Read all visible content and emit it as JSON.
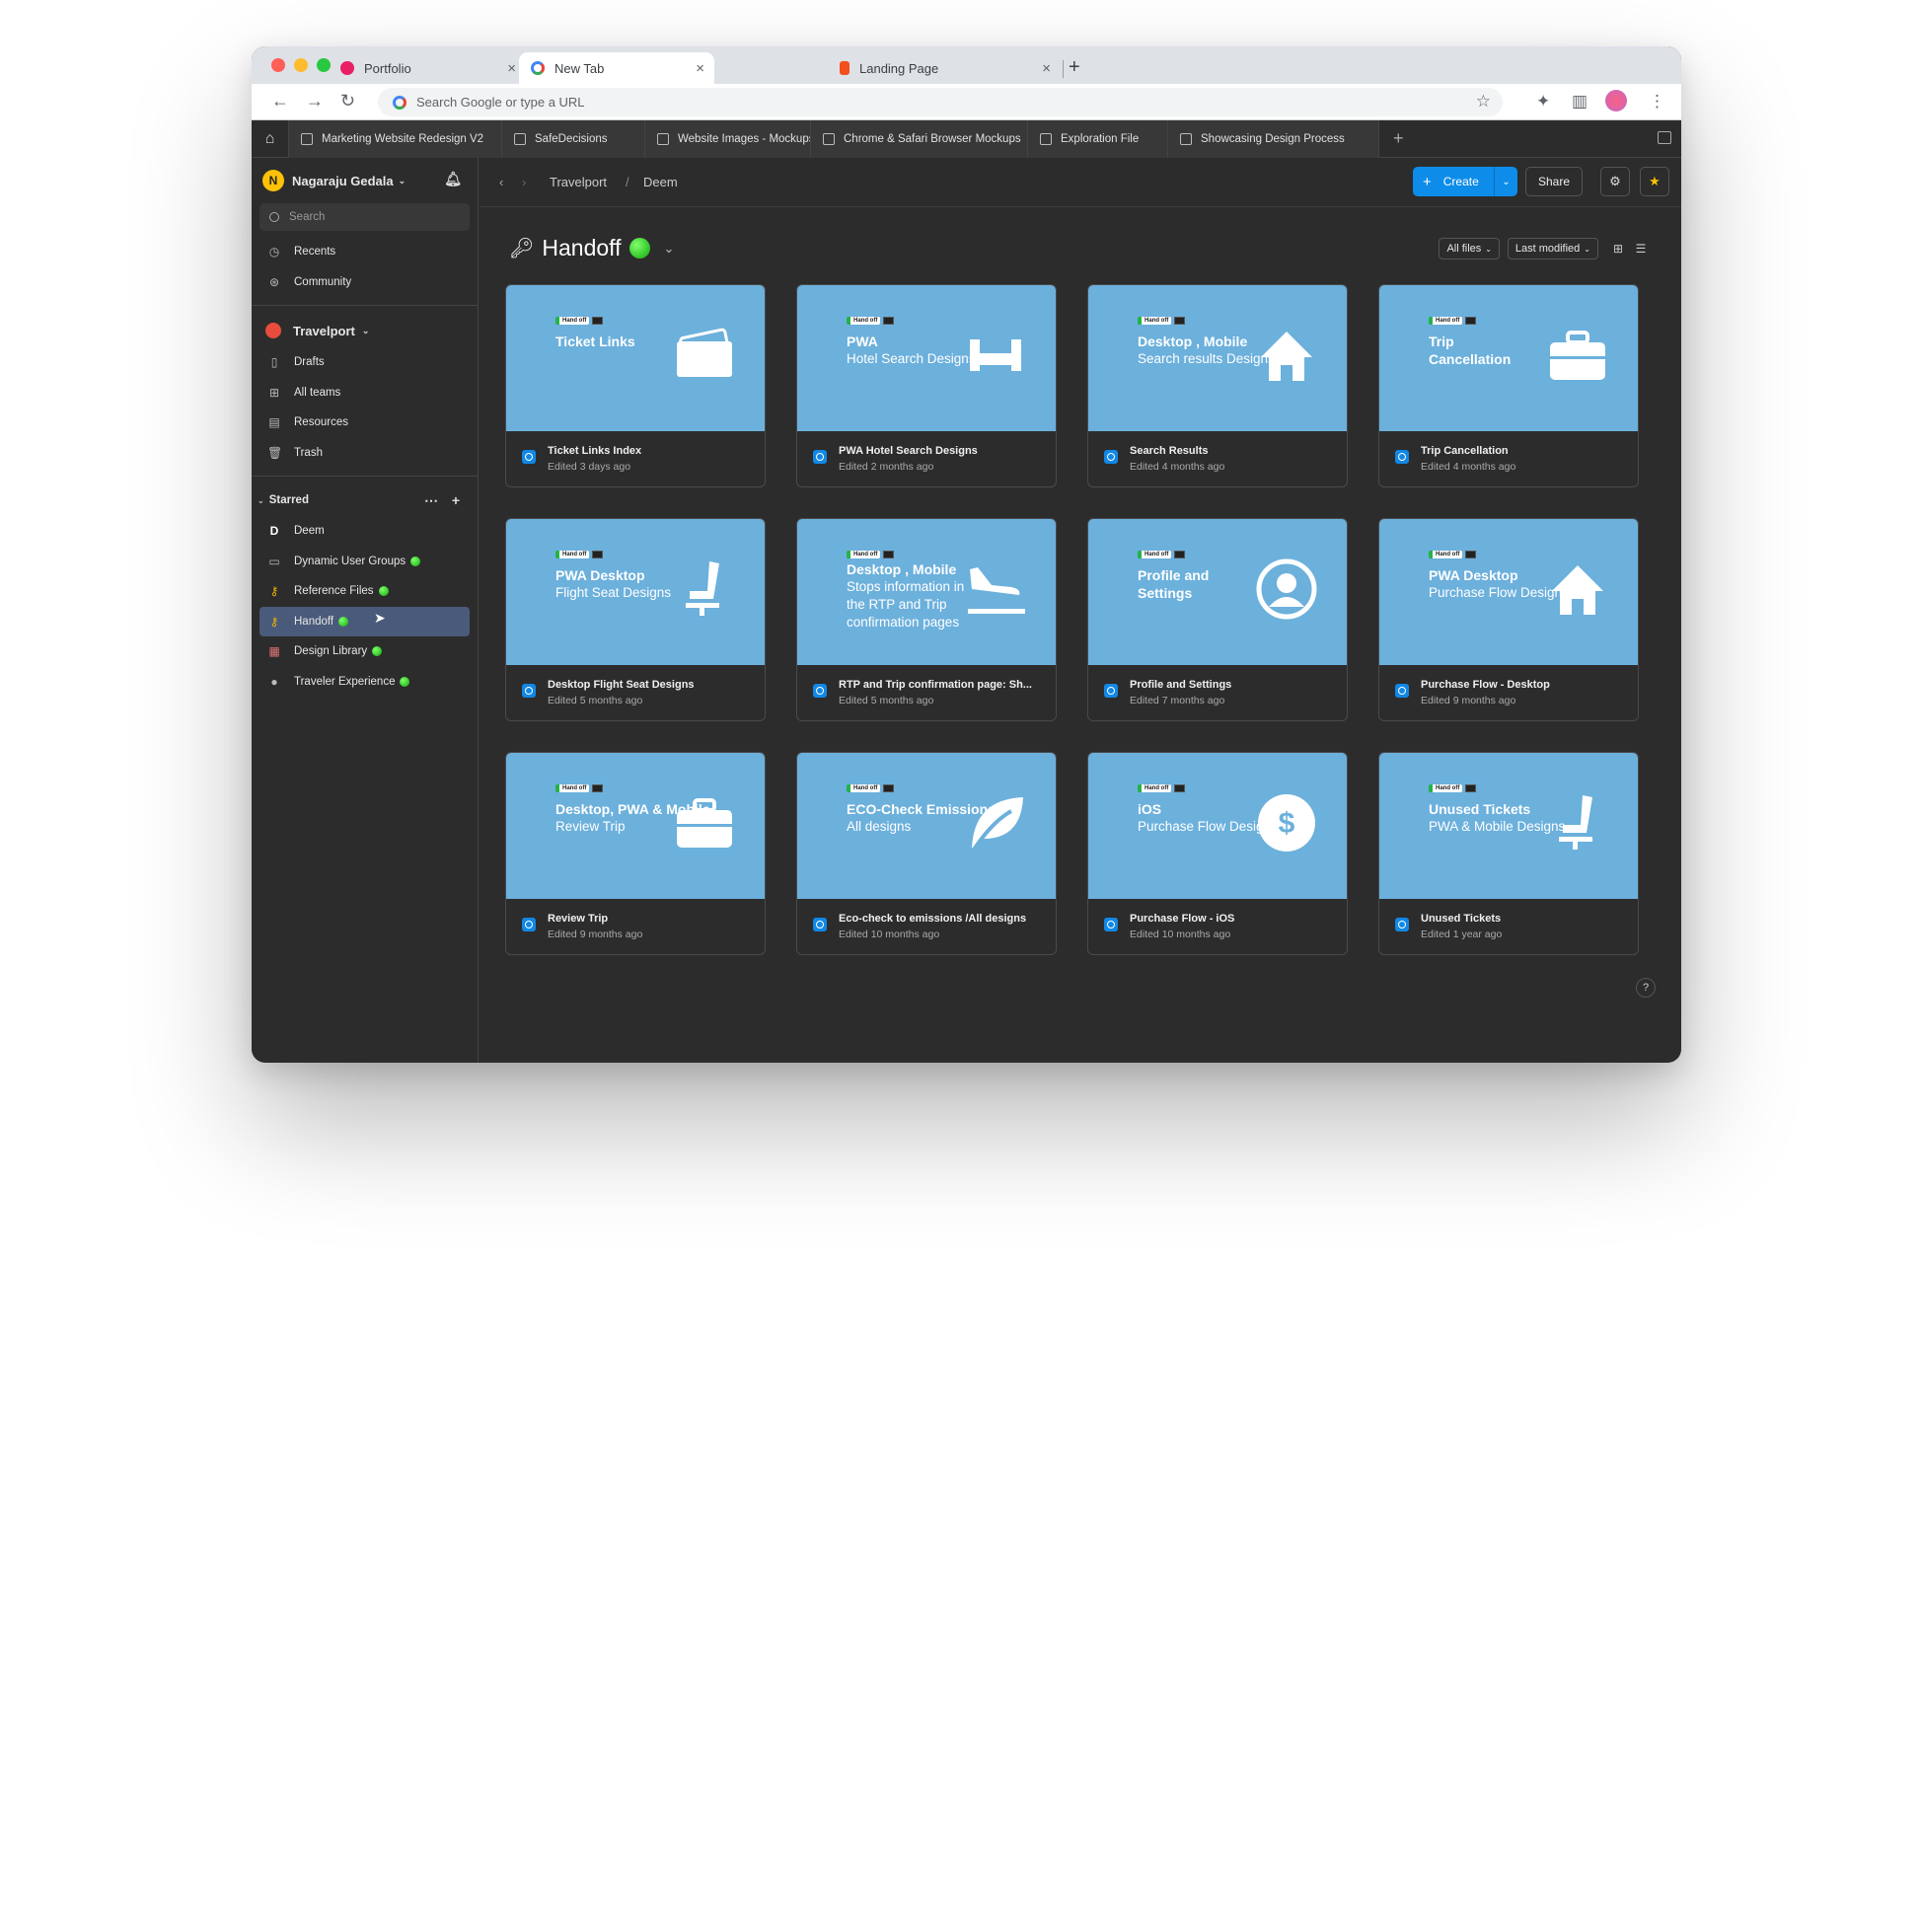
{
  "browser": {
    "tabs": [
      {
        "label": "Portfolio",
        "color": "#e91e63"
      },
      {
        "label": "New Tab",
        "color": "#4285f4"
      },
      {
        "label": "Landing Page",
        "color": "#f24e1e"
      }
    ],
    "url_placeholder": "Search Google or type a URL"
  },
  "figma_tabs": [
    "Marketing Website Redesign V2",
    "SafeDecisions",
    "Website Images - Mockups",
    "Chrome & Safari Browser Mockups",
    "Exploration File",
    "Showcasing Design Process"
  ],
  "sidebar": {
    "user": {
      "initial": "N",
      "name": "Nagaraju Gedala"
    },
    "search_placeholder": "Search",
    "nav": [
      {
        "label": "Recents",
        "icon": "clock-icon"
      },
      {
        "label": "Community",
        "icon": "globe-icon"
      }
    ],
    "team": {
      "name": "Travelport"
    },
    "team_items": [
      {
        "label": "Drafts",
        "icon": "file-icon"
      },
      {
        "label": "All teams",
        "icon": "grid-icon"
      },
      {
        "label": "Resources",
        "icon": "table-icon"
      },
      {
        "label": "Trash",
        "icon": "trash-icon"
      }
    ],
    "starred_label": "Starred",
    "starred": [
      {
        "label": "Deem",
        "dot": false
      },
      {
        "label": "Dynamic User Groups",
        "dot": true
      },
      {
        "label": "Reference Files",
        "dot": true
      },
      {
        "label": "Handoff",
        "dot": true
      },
      {
        "label": "Design Library",
        "dot": true
      },
      {
        "label": "Traveler Experience",
        "dot": true
      }
    ]
  },
  "header": {
    "breadcrumb": [
      "Travelport",
      "/",
      "Deem"
    ],
    "create_label": "Create",
    "share_label": "Share"
  },
  "page": {
    "title": "Handoff",
    "filter_files": "All files",
    "filter_sort": "Last modified"
  },
  "files": [
    {
      "thumb_title": "Ticket Links",
      "thumb_sub": "",
      "art": "ticket",
      "name": "Ticket Links Index",
      "edited": "Edited 3 days ago"
    },
    {
      "thumb_title": "PWA",
      "thumb_sub": "Hotel Search Designs",
      "art": "bed",
      "name": "PWA  Hotel Search Designs",
      "edited": "Edited 2 months ago"
    },
    {
      "thumb_title": "Desktop , Mobile",
      "thumb_sub": "Search results Designs",
      "art": "house",
      "name": "Search Results",
      "edited": "Edited 4 months ago"
    },
    {
      "thumb_title": "Trip Cancellation",
      "thumb_sub": "",
      "art": "briefcase",
      "name": "Trip Cancellation",
      "edited": "Edited 4 months ago"
    },
    {
      "thumb_title": "PWA Desktop",
      "thumb_sub": "Flight Seat Designs",
      "art": "seat",
      "name": "Desktop Flight Seat Designs",
      "edited": "Edited 5 months ago"
    },
    {
      "thumb_title": "Desktop , Mobile",
      "thumb_sub": "Stops information in the RTP and Trip confirmation pages",
      "art": "plane",
      "name": "RTP and Trip confirmation page: Sh...",
      "edited": "Edited 5 months ago"
    },
    {
      "thumb_title": "Profile and Settings",
      "thumb_sub": "",
      "art": "user",
      "name": "Profile and Settings",
      "edited": "Edited 7 months ago"
    },
    {
      "thumb_title": "PWA Desktop",
      "thumb_sub": "Purchase Flow Designs",
      "art": "house",
      "name": "Purchase Flow - Desktop",
      "edited": "Edited 9 months ago"
    },
    {
      "thumb_title": "Desktop, PWA & Mobile",
      "thumb_sub": "Review Trip",
      "art": "briefcase",
      "name": "Review Trip",
      "edited": "Edited 9 months ago"
    },
    {
      "thumb_title": "ECO-Check Emissions",
      "thumb_sub": "All designs",
      "art": "leaf",
      "name": "Eco-check to emissions /All designs",
      "edited": "Edited 10 months ago"
    },
    {
      "thumb_title": "iOS",
      "thumb_sub": "Purchase Flow Designs",
      "art": "dollar",
      "name": "Purchase Flow - iOS",
      "edited": "Edited 10 months ago"
    },
    {
      "thumb_title": "Unused Tickets",
      "thumb_sub": "PWA & Mobile Designs",
      "art": "seat",
      "name": "Unused Tickets",
      "edited": "Edited 1 year ago"
    }
  ],
  "badge_label": "Hand off",
  "help_label": "?",
  "colors": {
    "thumb_bg": "#6cb0dc",
    "accent": "#0d8ce9",
    "selected": "#4a5a7a"
  }
}
